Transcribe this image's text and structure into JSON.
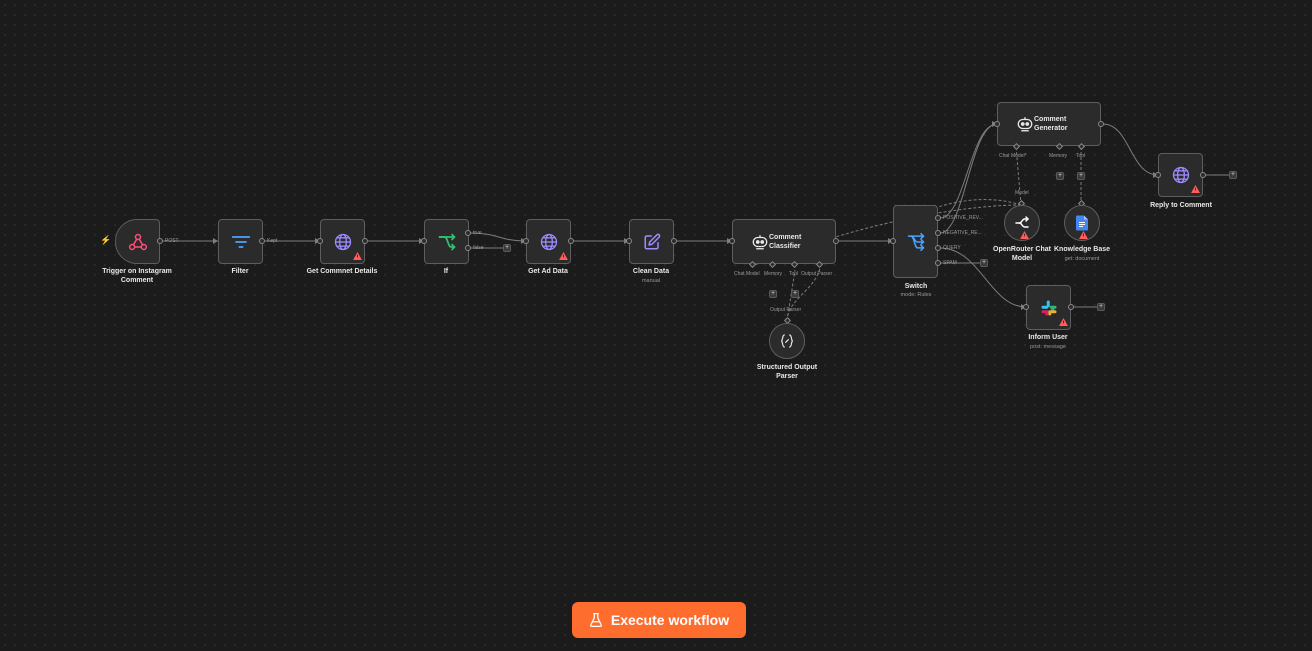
{
  "colors": {
    "accent": "#ff6d2e",
    "background": "#1b1b1c",
    "node_fill": "#2b2b2c",
    "node_border": "#5e5e60",
    "warning": "#ff5c5c",
    "webhook_icon": "#ff4d7a",
    "http_icon": "#9b8cff",
    "if_icon": "#2fc46f",
    "filter_icon": "#4aa3ff",
    "edit_icon": "#9b8cff",
    "switch_icon": "#4aa3ff",
    "docs_icon": "#4285f4"
  },
  "nodes": {
    "trigger": {
      "label_line1": "Trigger on Instagram",
      "label_line2": "Comment",
      "icon": "webhook-icon",
      "output_label": "POST"
    },
    "filter": {
      "label": "Filter",
      "icon": "filter-icon",
      "output_label": "Kept"
    },
    "get_comment_details": {
      "label": "Get Commnet Details",
      "icon": "globe-icon"
    },
    "if": {
      "label": "If",
      "icon": "if-branch-icon",
      "true_label": "true",
      "false_label": "false"
    },
    "get_ad_data": {
      "label": "Get Ad Data",
      "icon": "globe-icon"
    },
    "clean_data": {
      "label": "Clean Data",
      "subtitle": "manual",
      "icon": "edit-icon"
    },
    "comment_classifier": {
      "title_line1": "Comment",
      "title_line2": "Classifier",
      "icon": "robot-icon",
      "port_chat_model": "Chat Model",
      "port_memory": "Memory",
      "port_tool": "Tool",
      "port_output_parser": "Output Parser"
    },
    "structured_output_parser": {
      "label_line1": "Structured Output",
      "label_line2": "Parser",
      "icon": "braces-icon",
      "port_label": "Output Parser"
    },
    "switch": {
      "label": "Switch",
      "subtitle": "mode: Rules",
      "icon": "switch-icon",
      "outputs": [
        "POSITIVE_REV...",
        "NEGATIVE_RE...",
        "QUERY",
        "SPAM"
      ]
    },
    "comment_generator": {
      "title_line1": "Comment",
      "title_line2": "Generator",
      "icon": "robot-icon",
      "port_chat_model": "Chat Model*",
      "port_memory": "Memory",
      "port_tool": "Tool"
    },
    "openrouter": {
      "label_line1": "OpenRouter Chat",
      "label_line2": "Model",
      "icon": "openrouter-icon",
      "port_label": "Model"
    },
    "knowledge_base": {
      "label": "Knowledge Base",
      "subtitle": "get: document",
      "icon": "google-docs-icon"
    },
    "reply_to_comment": {
      "label": "Reply to Comment",
      "icon": "globe-icon"
    },
    "inform_user": {
      "label": "Inform User",
      "subtitle": "post: message",
      "icon": "slack-icon"
    }
  },
  "execute_button": {
    "label": "Execute workflow",
    "icon": "flask-icon"
  }
}
